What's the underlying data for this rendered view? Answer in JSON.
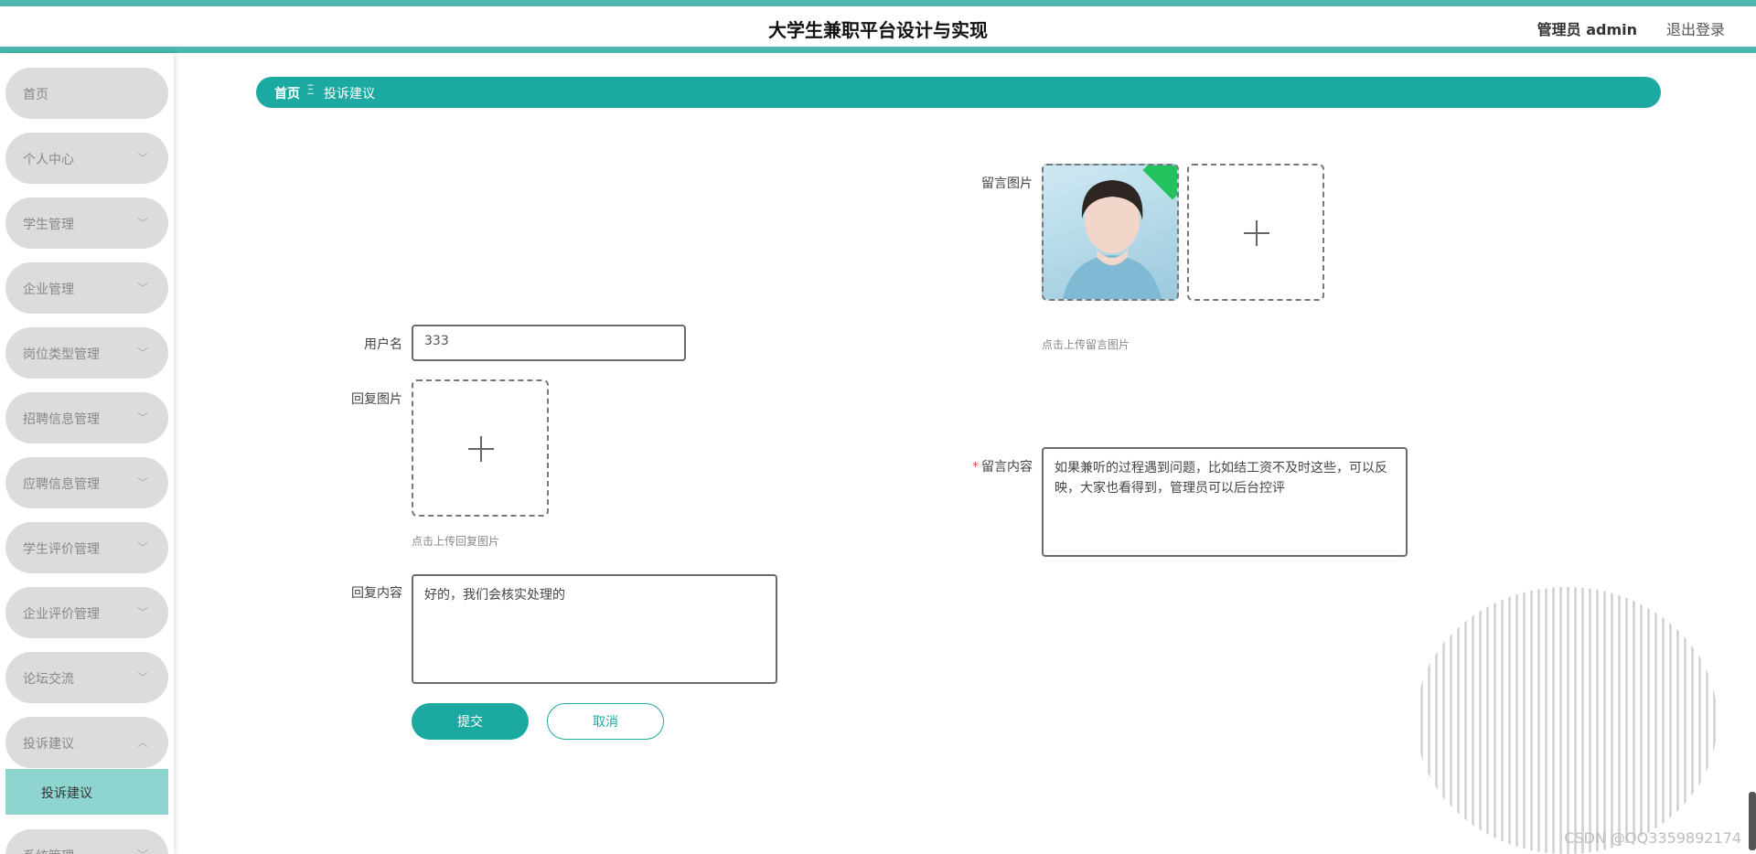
{
  "header": {
    "title": "大学生兼职平台设计与实现",
    "admin_label": "管理员 admin",
    "logout_label": "退出登录"
  },
  "sidebar": {
    "items": [
      {
        "label": "首页",
        "icon": "none"
      },
      {
        "label": "个人中心",
        "icon": "chevron-down-icon"
      },
      {
        "label": "学生管理",
        "icon": "chevron-down-icon"
      },
      {
        "label": "企业管理",
        "icon": "chevron-down-icon"
      },
      {
        "label": "岗位类型管理",
        "icon": "chevron-down-icon"
      },
      {
        "label": "招聘信息管理",
        "icon": "chevron-down-icon"
      },
      {
        "label": "应聘信息管理",
        "icon": "chevron-down-icon"
      },
      {
        "label": "学生评价管理",
        "icon": "chevron-down-icon"
      },
      {
        "label": "企业评价管理",
        "icon": "chevron-down-icon"
      },
      {
        "label": "论坛交流",
        "icon": "chevron-down-icon"
      },
      {
        "label": "投诉建议",
        "icon": "chevron-up-icon"
      },
      {
        "label": "系统管理",
        "icon": "chevron-down-icon"
      }
    ],
    "sub_item": "投诉建议"
  },
  "breadcrumb": {
    "home": "首页",
    "separator": "Ξ",
    "current": "投诉建议"
  },
  "form": {
    "username_label": "用户名",
    "username_value": "333",
    "reply_image_label": "回复图片",
    "reply_image_hint": "点击上传回复图片",
    "reply_content_label": "回复内容",
    "reply_content_value": "好的，我们会核实处理的",
    "message_image_label": "留言图片",
    "message_image_hint": "点击上传留言图片",
    "message_content_label": "留言内容",
    "message_content_required": "*",
    "message_content_value": "如果兼听的过程遇到问题，比如结工资不及时这些，可以反映，大家也看得到，管理员可以后台控评",
    "submit_label": "提交",
    "cancel_label": "取消"
  },
  "watermark": "CSDN @QQ3359892174",
  "colors": {
    "accent": "#1ca9a2",
    "stripe": "#4bb7ae",
    "submenu_active": "#8ed5d0",
    "menu_bg": "#dcdcdc"
  }
}
